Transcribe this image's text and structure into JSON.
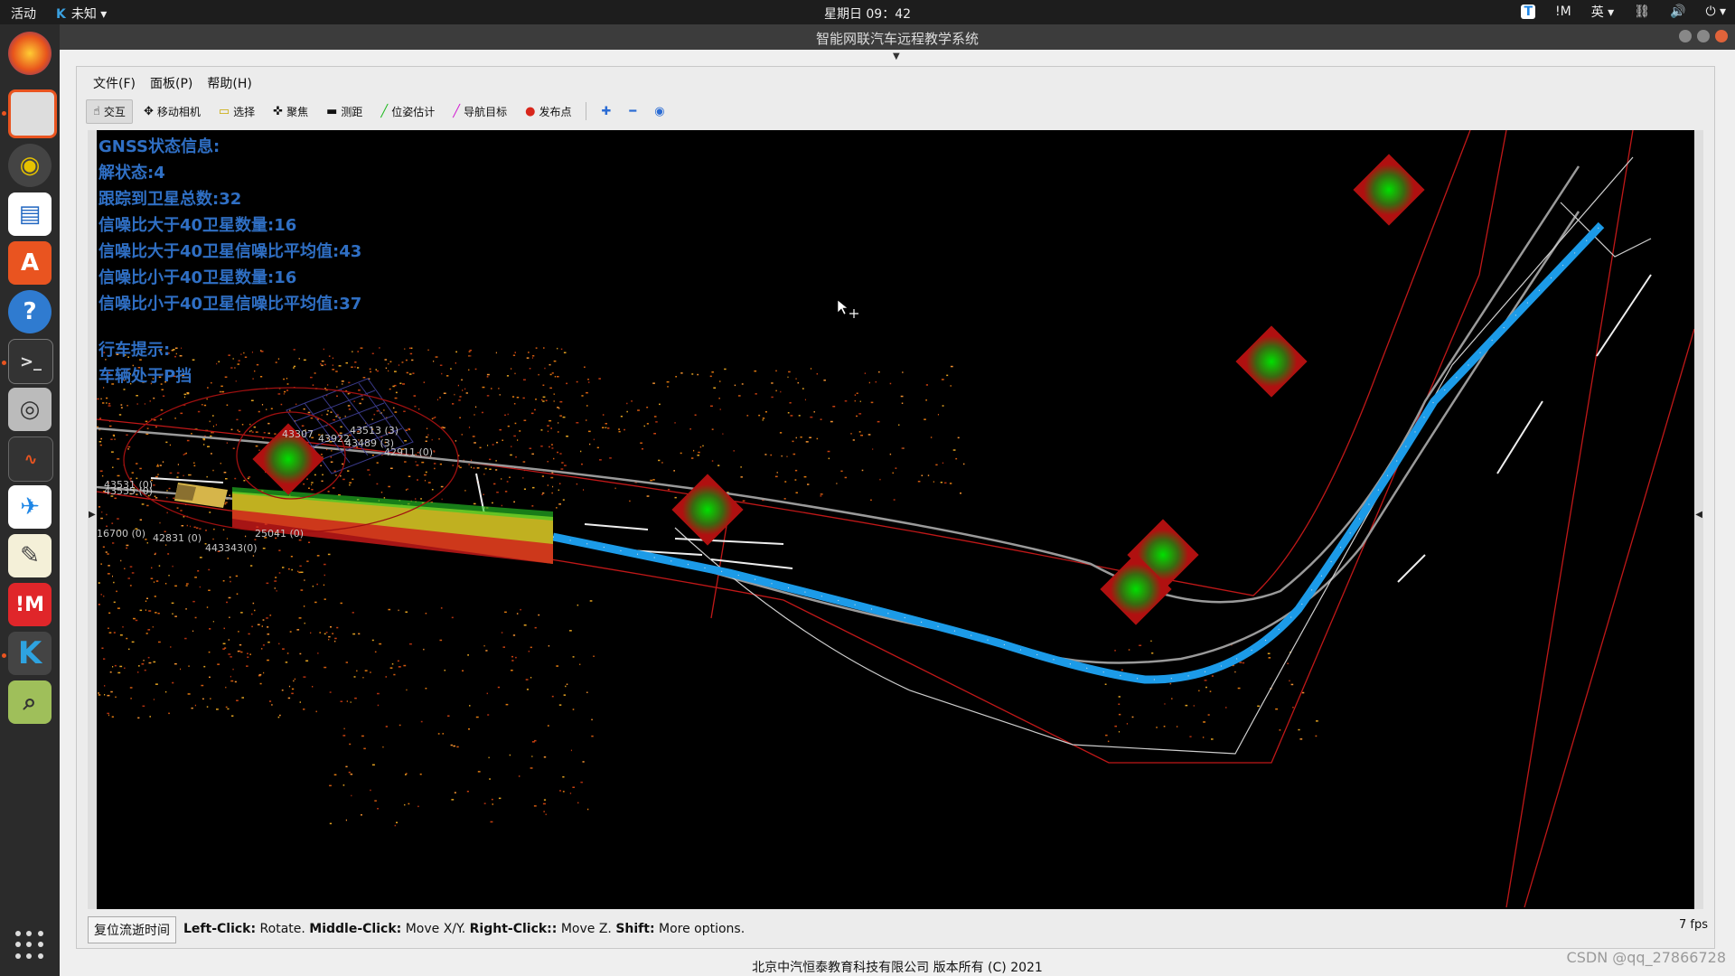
{
  "topbar": {
    "activities": "活动",
    "app_menu": "未知",
    "clock": "星期日 09：42",
    "tray": {
      "input_method": "英",
      "mi_label": "!M"
    }
  },
  "dock": {
    "items": [
      "firefox-icon",
      "files-icon",
      "rhythmbox-icon",
      "writer-icon",
      "software-icon",
      "help-icon",
      "terminal-icon",
      "camera-icon",
      "monitor-icon",
      "teamviewer-icon",
      "text-editor-icon",
      "mi-icon",
      "kylin-icon",
      "image-viewer-icon"
    ]
  },
  "window": {
    "title": "智能网联汽车远程教学系统"
  },
  "menu": {
    "file": "文件(F)",
    "panels": "面板(P)",
    "help": "帮助(H)"
  },
  "toolbar": {
    "interact": "交互",
    "move_camera": "移动相机",
    "select": "选择",
    "focus": "聚焦",
    "measure": "测距",
    "pose_estimate": "位姿估计",
    "nav_goal": "导航目标",
    "publish_point": "发布点"
  },
  "gnss": {
    "title": "GNSS状态信息:",
    "solution": "解状态:4",
    "tracked": "跟踪到卫星总数:32",
    "snr_gt40_count": "信噪比大于40卫星数量:16",
    "snr_gt40_avg": "信噪比大于40卫星信噪比平均值:43",
    "snr_lt40_count": "信噪比小于40卫星数量:16",
    "snr_lt40_avg": "信噪比小于40卫星信噪比平均值:37",
    "drive_title": "行车提示:",
    "drive_msg": "车辆处于P挡"
  },
  "point_labels": [
    "43307",
    "43922",
    "43513 (3)",
    "43489 (3)",
    "42911 (0)",
    "43531 (0)",
    "43535 (0)",
    "16700 (0)",
    "42831 (0)",
    "25041 (0)",
    "443343(0)"
  ],
  "status": {
    "reset_button": "复位流逝时间",
    "hint_lc": "Left-Click:",
    "hint_lc_val": " Rotate. ",
    "hint_mc": "Middle-Click:",
    "hint_mc_val": " Move X/Y. ",
    "hint_rc": "Right-Click::",
    "hint_rc_val": " Move Z. ",
    "hint_shift": "Shift:",
    "hint_shift_val": " More options.",
    "fps": "7 fps"
  },
  "footer": "北京中汽恒泰教育科技有限公司 版本所有 (C) 2021",
  "watermark": "CSDN @qq_27866728"
}
